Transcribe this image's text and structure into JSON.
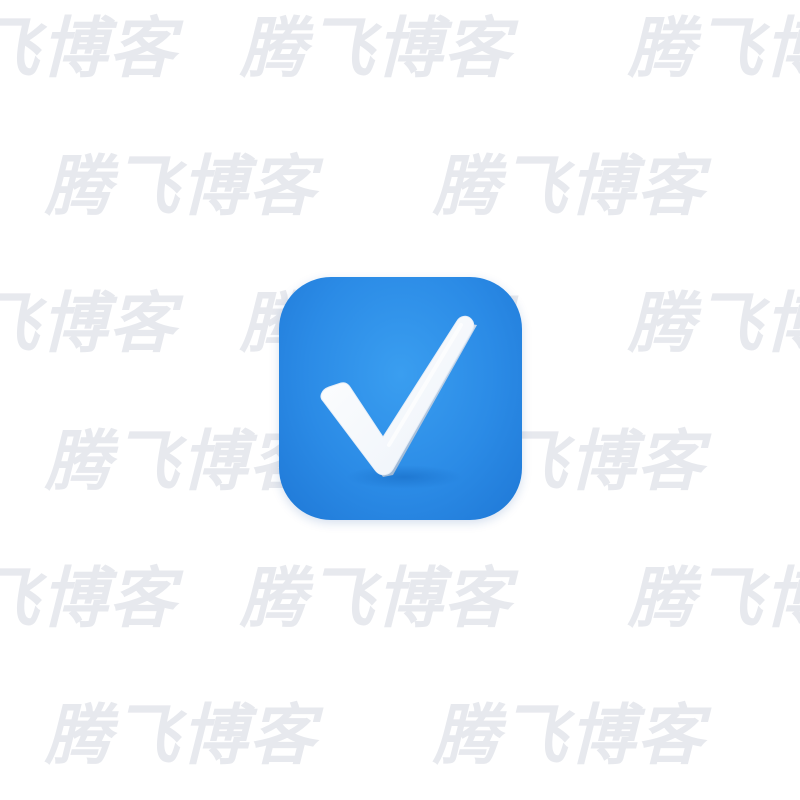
{
  "watermark": {
    "text": "腾飞博客",
    "color": "#e7e9ee"
  },
  "app_icon": {
    "icon": "checkmark-icon",
    "background_color": "#2b8be6",
    "glyph_color": "#ffffff"
  }
}
